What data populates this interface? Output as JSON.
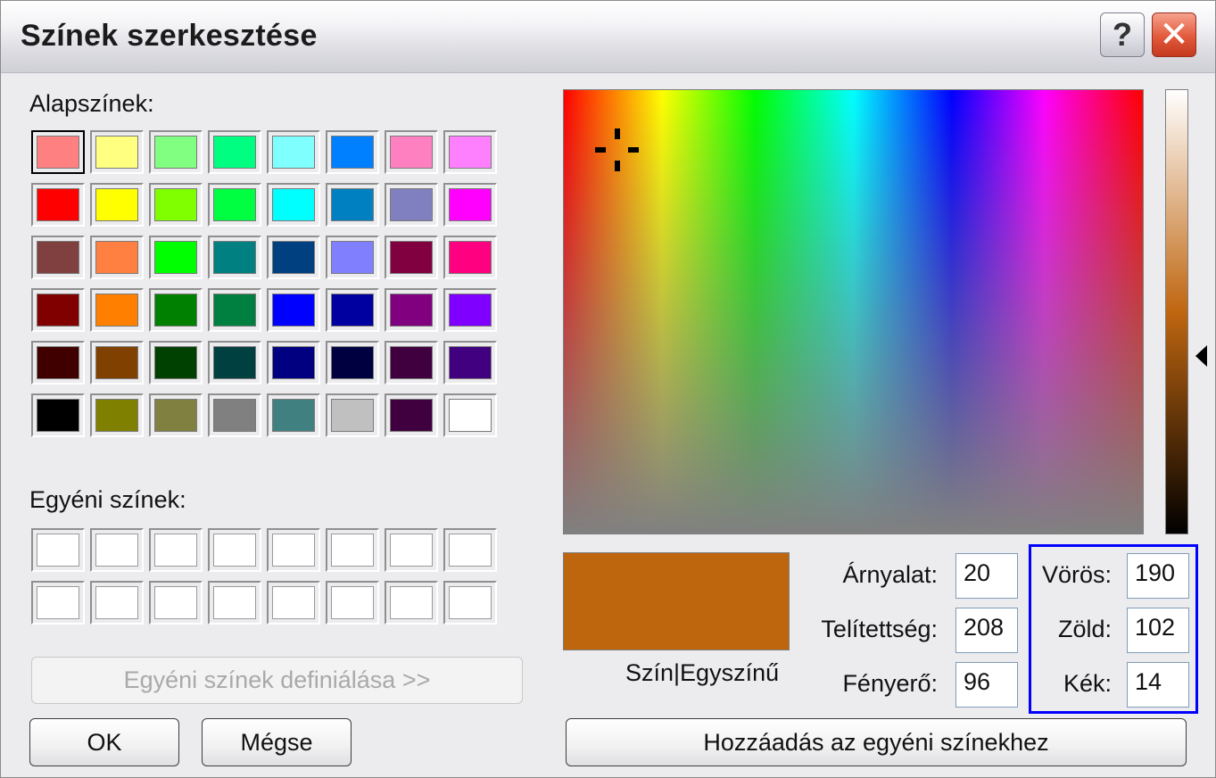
{
  "window": {
    "title": "Színek szerkesztése",
    "help_label": "?",
    "close_label": "✕"
  },
  "basic": {
    "label": "Alapszínek:",
    "colors": [
      "#ff8080",
      "#ffff80",
      "#80ff80",
      "#00ff80",
      "#80ffff",
      "#0080ff",
      "#ff80c0",
      "#ff80ff",
      "#ff0000",
      "#ffff00",
      "#80ff00",
      "#00ff40",
      "#00ffff",
      "#0080c0",
      "#8080c0",
      "#ff00ff",
      "#804040",
      "#ff8040",
      "#00ff00",
      "#008080",
      "#004080",
      "#8080ff",
      "#800040",
      "#ff0080",
      "#800000",
      "#ff8000",
      "#008000",
      "#008040",
      "#0000ff",
      "#0000a0",
      "#800080",
      "#8000ff",
      "#400000",
      "#804000",
      "#004000",
      "#004040",
      "#000080",
      "#000040",
      "#400040",
      "#400080",
      "#000000",
      "#808000",
      "#808040",
      "#808080",
      "#408080",
      "#c0c0c0",
      "#400040",
      "#ffffff"
    ],
    "selected_index": 0
  },
  "custom": {
    "label": "Egyéni színek:",
    "count": 16,
    "color": "#ffffff"
  },
  "buttons": {
    "define": "Egyéni színek definiálása >>",
    "ok": "OK",
    "cancel": "Mégse",
    "add": "Hozzáadás az egyéni színekhez"
  },
  "preview": {
    "color": "#be660e",
    "caption": "Szín|Egyszínű"
  },
  "hsl": {
    "hue_label": "Árnyalat:",
    "hue": "20",
    "sat_label": "Telítettség:",
    "sat": "208",
    "lum_label": "Fényerő:",
    "lum": "96"
  },
  "rgb": {
    "red_label": "Vörös:",
    "red": "190",
    "green_label": "Zöld:",
    "green": "102",
    "blue_label": "Kék:",
    "blue": "14"
  },
  "colors": {
    "highlight_border": "#0000ff"
  }
}
